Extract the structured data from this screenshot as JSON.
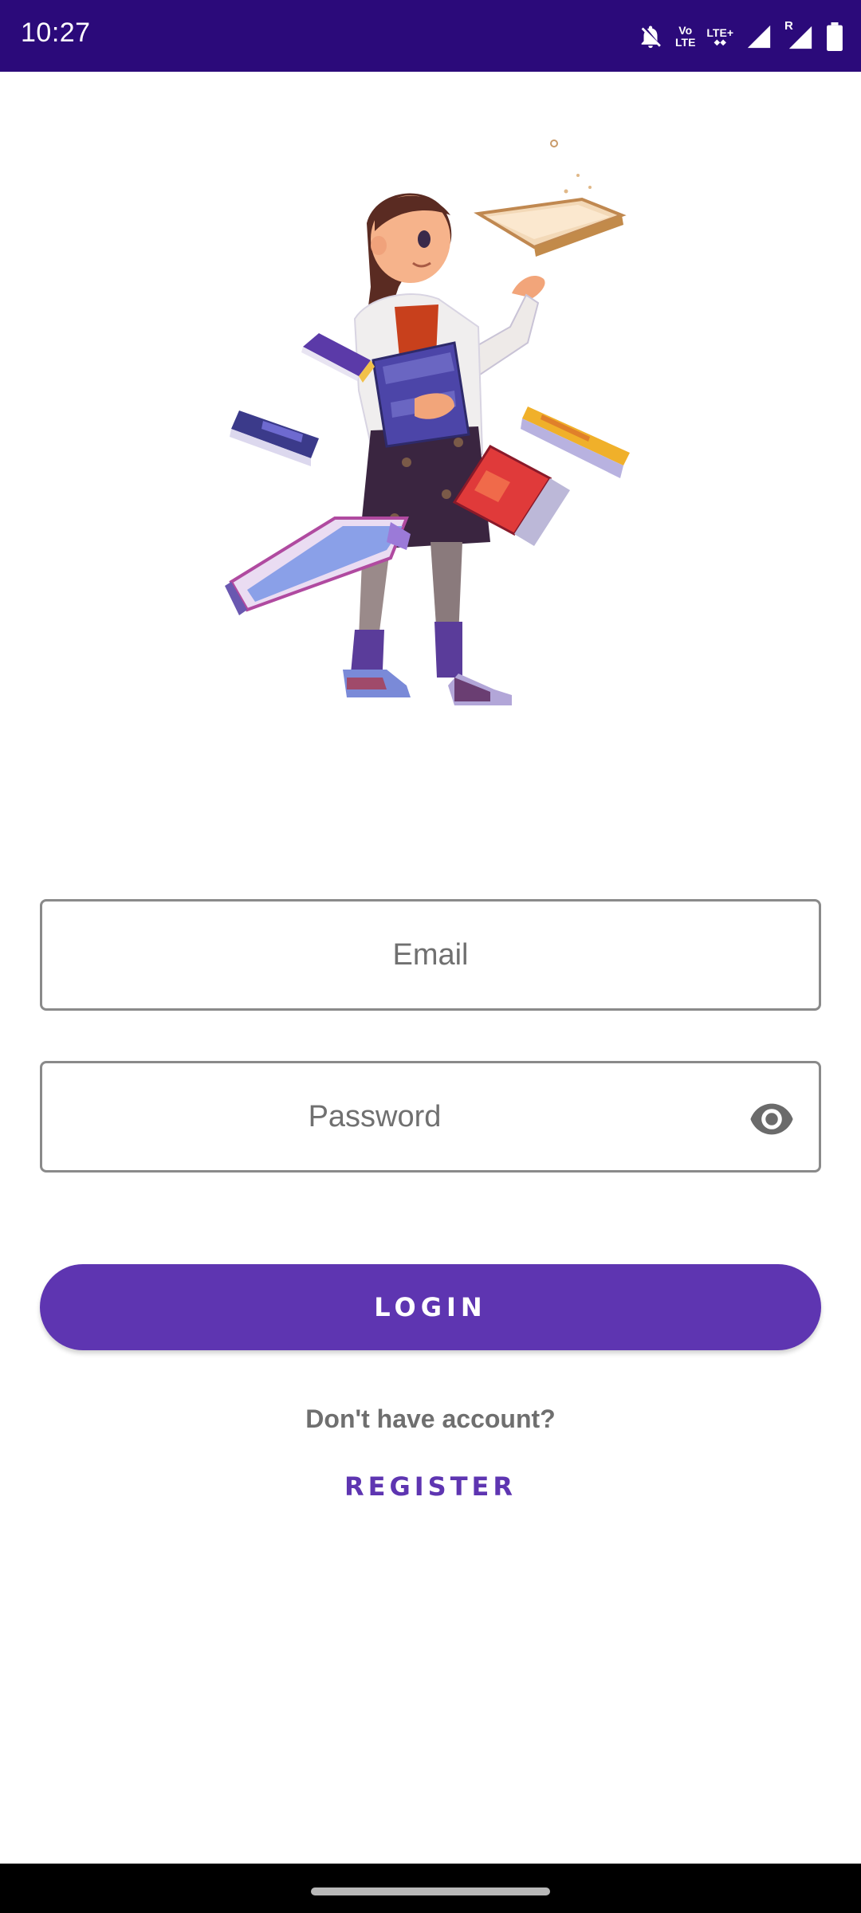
{
  "status_bar": {
    "time": "10:27",
    "volte_top": "Vo",
    "volte_bottom": "LTE",
    "lte_label": "LTE+",
    "roaming_label": "R",
    "icons": [
      "notifications-off-icon",
      "volte-icon",
      "lte-plus-icon",
      "signal-icon",
      "roaming-signal-icon",
      "battery-icon"
    ]
  },
  "login_form": {
    "email_placeholder": "Email",
    "password_placeholder": "Password",
    "login_label": "LOGIN",
    "no_account_text": "Don't have account?",
    "register_label": "REGISTER"
  },
  "colors": {
    "status_bar": "#2b0a7a",
    "accent": "#5e35b1",
    "field_border": "#8a8a8a"
  }
}
